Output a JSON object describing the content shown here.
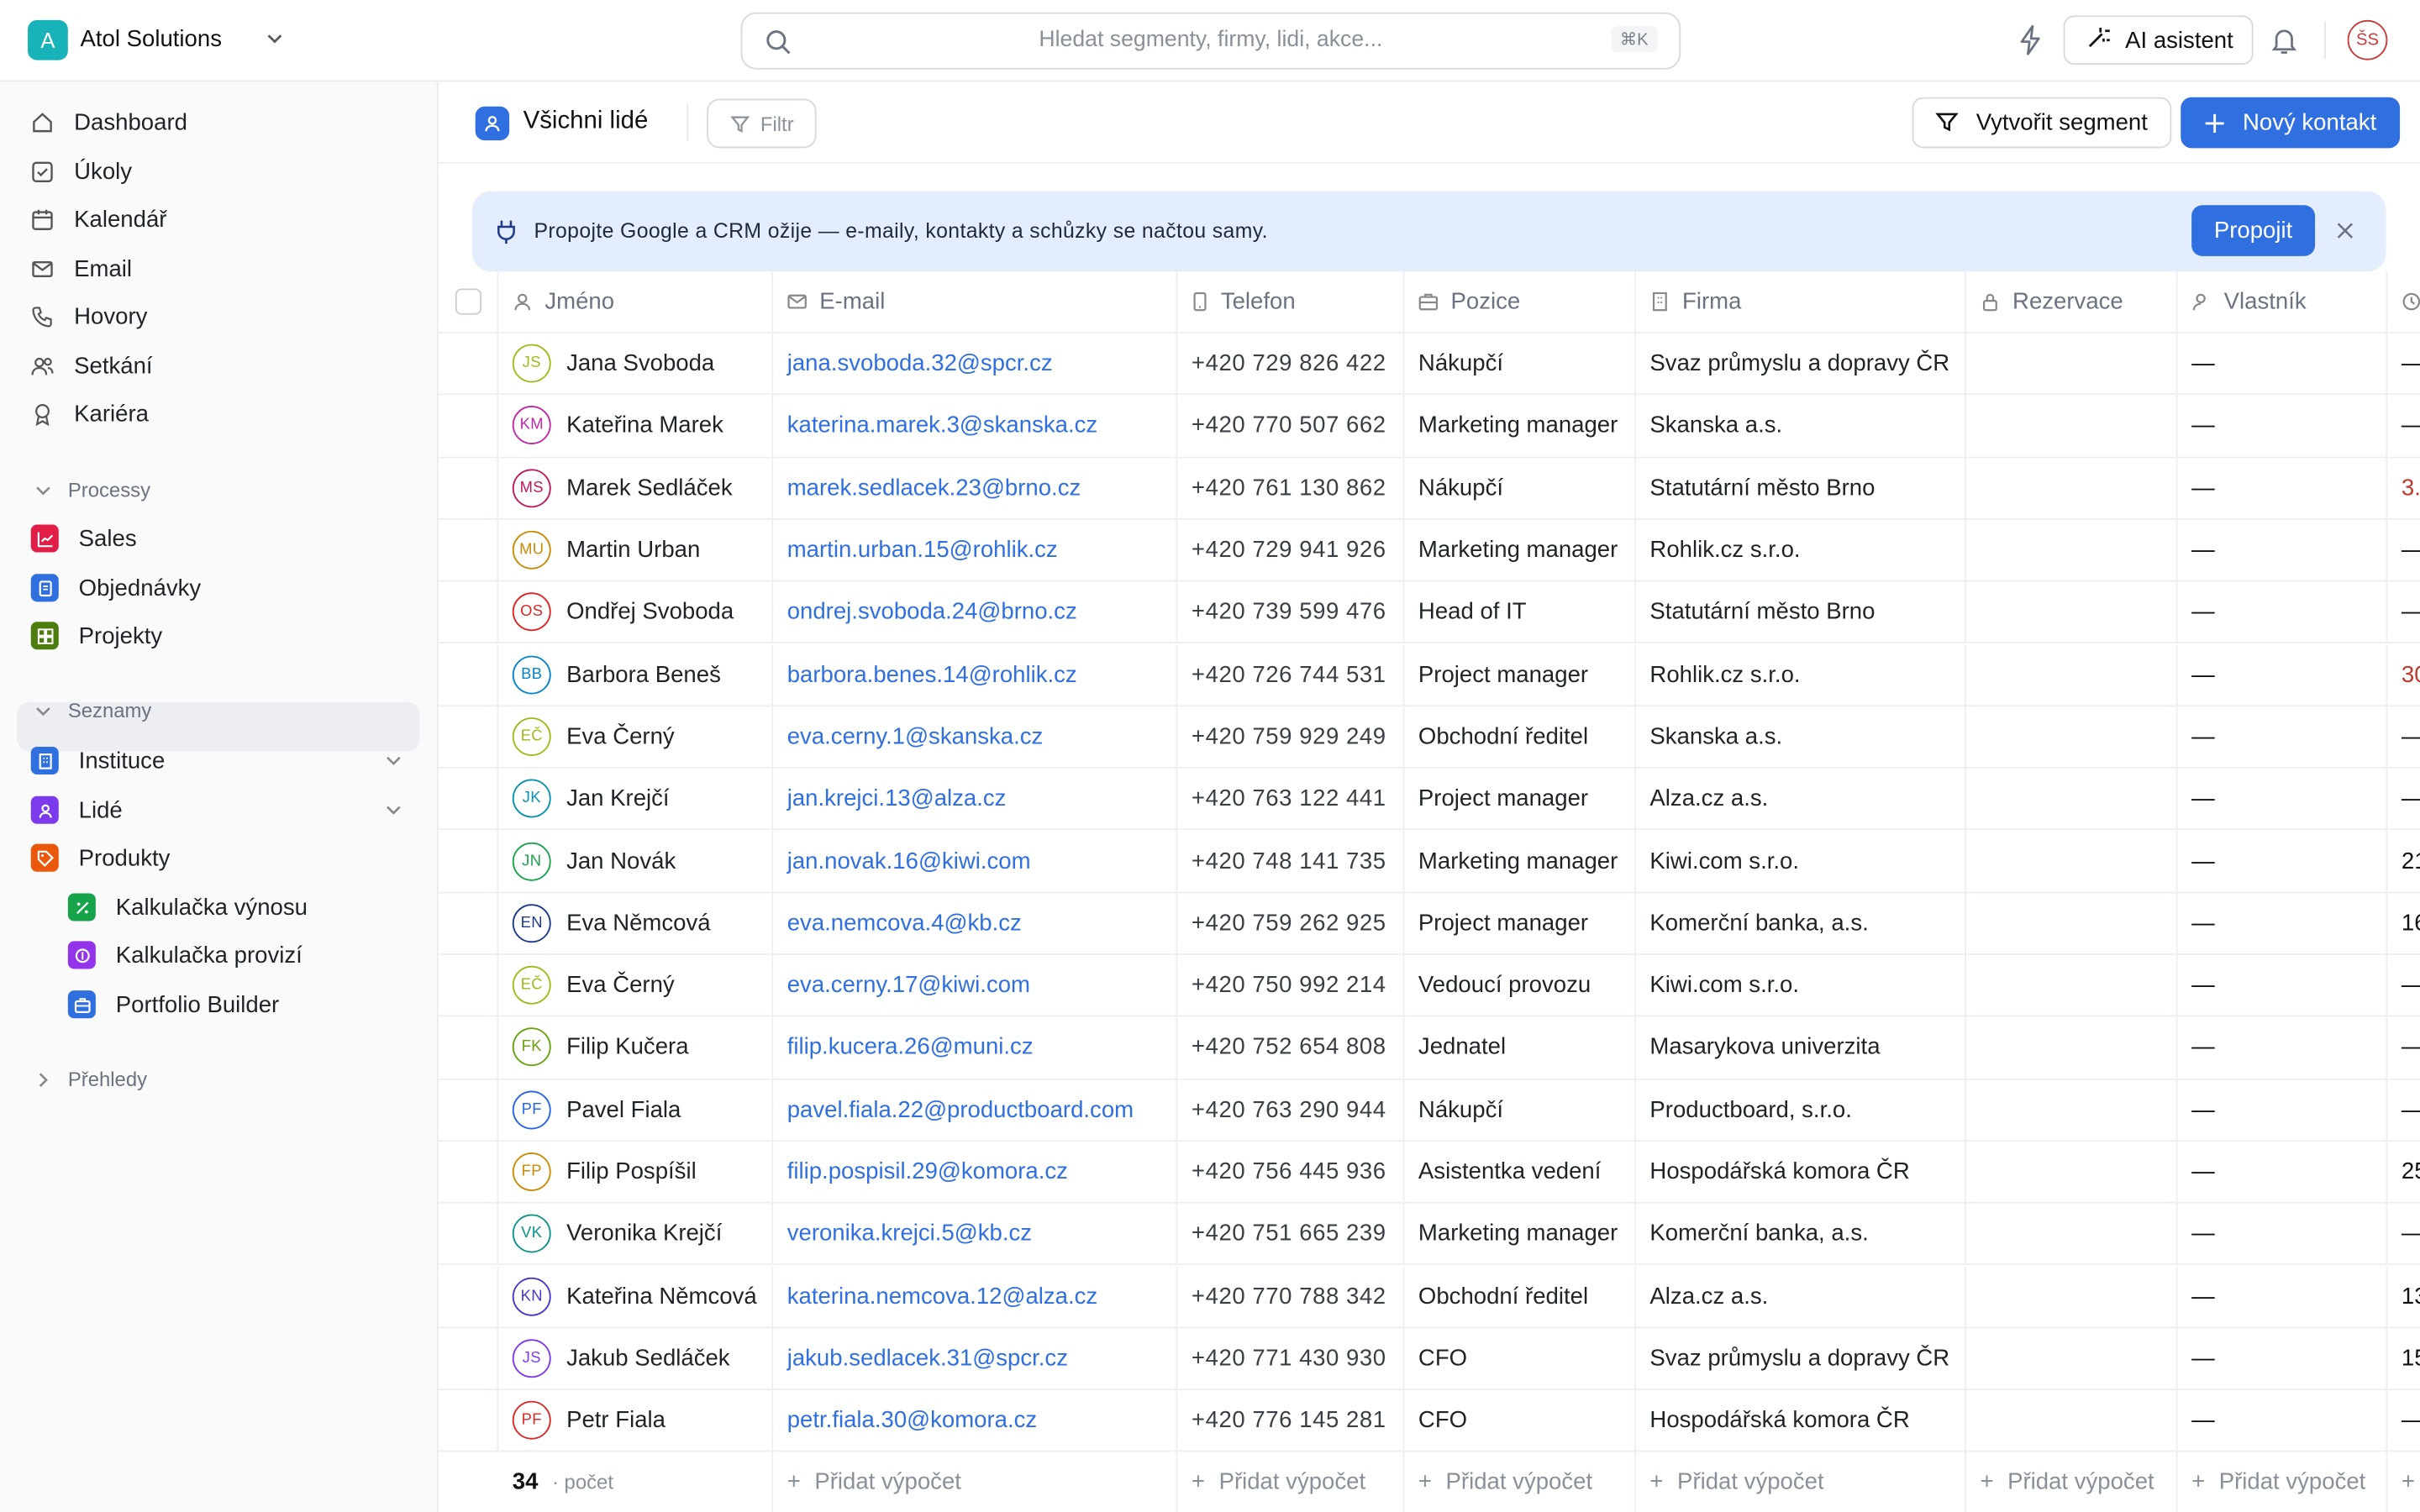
{
  "workspace": {
    "initial": "A",
    "name": "Atol Solutions"
  },
  "search": {
    "placeholder": "Hledat segmenty, firmy, lidi, akce...",
    "shortcut": "⌘K"
  },
  "topbar": {
    "ai_label": "AI asistent",
    "user_initials": "ŠS"
  },
  "sidebar": {
    "nav": [
      "Dashboard",
      "Úkoly",
      "Kalendář",
      "Email",
      "Hovory",
      "Setkání",
      "Kariéra"
    ],
    "processes_header": "Processy",
    "processes": [
      {
        "label": "Sales",
        "color": "#e11d48"
      },
      {
        "label": "Objednávky",
        "color": "#2f6fe0"
      },
      {
        "label": "Projekty",
        "color": "#4d7c0f"
      }
    ],
    "lists_header": "Seznamy",
    "lists": [
      {
        "label": "Instituce",
        "color": "#2f6fe0"
      },
      {
        "label": "Lidé",
        "color": "#7c3aed"
      },
      {
        "label": "Produkty",
        "color": "#ea580c"
      }
    ],
    "products_sub": [
      {
        "label": "Kalkulačka výnosu",
        "color": "#16a34a"
      },
      {
        "label": "Kalkulačka provizí",
        "color": "#9333ea"
      },
      {
        "label": "Portfolio Builder",
        "color": "#2f6fe0"
      }
    ],
    "overviews_header": "Přehledy"
  },
  "view": {
    "title": "Všichni lidé",
    "filter_label": "Filtr",
    "segment_button": "Vytvořit segment",
    "new_button": "Nový kontakt"
  },
  "banner": {
    "text": "Propojte Google a CRM ožije — e-maily, kontakty a schůzky se načtou samy.",
    "button": "Propojit"
  },
  "table": {
    "columns": [
      "Jméno",
      "E-mail",
      "Telefon",
      "Pozice",
      "Firma",
      "Rezervace",
      "Vlastník"
    ],
    "rows": [
      {
        "initials": "JS",
        "color": "#a3b81a",
        "name": "Jana Svoboda",
        "email": "jana.svoboda.32@spcr.cz",
        "phone": "+420 729 826 422",
        "position": "Nákupčí",
        "company": "Svaz průmyslu a dopravy ČR",
        "owner": "—",
        "extra": "—",
        "extra_red": false
      },
      {
        "initials": "KM",
        "color": "#c026a8",
        "name": "Kateřina Marek",
        "email": "katerina.marek.3@skanska.cz",
        "phone": "+420 770 507 662",
        "position": "Marketing manager",
        "company": "Skanska a.s.",
        "owner": "—",
        "extra": "—",
        "extra_red": false
      },
      {
        "initials": "MS",
        "color": "#be185d",
        "name": "Marek Sedláček",
        "email": "marek.sedlacek.23@brno.cz",
        "phone": "+420 761 130 862",
        "position": "Nákupčí",
        "company": "Statutární město Brno",
        "owner": "—",
        "extra": "3.",
        "extra_red": true
      },
      {
        "initials": "MU",
        "color": "#ca8a04",
        "name": "Martin Urban",
        "email": "martin.urban.15@rohlik.cz",
        "phone": "+420 729 941 926",
        "position": "Marketing manager",
        "company": "Rohlik.cz s.r.o.",
        "owner": "—",
        "extra": "—",
        "extra_red": false
      },
      {
        "initials": "OS",
        "color": "#dc2626",
        "name": "Ondřej Svoboda",
        "email": "ondrej.svoboda.24@brno.cz",
        "phone": "+420 739 599 476",
        "position": "Head of IT",
        "company": "Statutární město Brno",
        "owner": "—",
        "extra": "—",
        "extra_red": false
      },
      {
        "initials": "BB",
        "color": "#0284c7",
        "name": "Barbora Beneš",
        "email": "barbora.benes.14@rohlik.cz",
        "phone": "+420 726 744 531",
        "position": "Project manager",
        "company": "Rohlik.cz s.r.o.",
        "owner": "—",
        "extra": "30",
        "extra_red": true
      },
      {
        "initials": "EČ",
        "color": "#a3b81a",
        "name": "Eva Černý",
        "email": "eva.cerny.1@skanska.cz",
        "phone": "+420 759 929 249",
        "position": "Obchodní ředitel",
        "company": "Skanska a.s.",
        "owner": "—",
        "extra": "—",
        "extra_red": false
      },
      {
        "initials": "JK",
        "color": "#0891b2",
        "name": "Jan Krejčí",
        "email": "jan.krejci.13@alza.cz",
        "phone": "+420 763 122 441",
        "position": "Project manager",
        "company": "Alza.cz a.s.",
        "owner": "—",
        "extra": "—",
        "extra_red": false
      },
      {
        "initials": "JN",
        "color": "#16a34a",
        "name": "Jan Novák",
        "email": "jan.novak.16@kiwi.com",
        "phone": "+420 748 141 735",
        "position": "Marketing manager",
        "company": "Kiwi.com s.r.o.",
        "owner": "—",
        "extra": "21",
        "extra_red": false
      },
      {
        "initials": "EN",
        "color": "#1e3a8a",
        "name": "Eva Němcová",
        "email": "eva.nemcova.4@kb.cz",
        "phone": "+420 759 262 925",
        "position": "Project manager",
        "company": "Komerční banka, a.s.",
        "owner": "—",
        "extra": "16",
        "extra_red": false
      },
      {
        "initials": "EČ",
        "color": "#a3b81a",
        "name": "Eva Černý",
        "email": "eva.cerny.17@kiwi.com",
        "phone": "+420 750 992 214",
        "position": "Vedoucí provozu",
        "company": "Kiwi.com s.r.o.",
        "owner": "—",
        "extra": "—",
        "extra_red": false
      },
      {
        "initials": "FK",
        "color": "#65a30d",
        "name": "Filip Kučera",
        "email": "filip.kucera.26@muni.cz",
        "phone": "+420 752 654 808",
        "position": "Jednatel",
        "company": "Masarykova univerzita",
        "owner": "—",
        "extra": "—",
        "extra_red": false
      },
      {
        "initials": "PF",
        "color": "#2563eb",
        "name": "Pavel Fiala",
        "email": "pavel.fiala.22@productboard.com",
        "phone": "+420 763 290 944",
        "position": "Nákupčí",
        "company": "Productboard, s.r.o.",
        "owner": "—",
        "extra": "—",
        "extra_red": false
      },
      {
        "initials": "FP",
        "color": "#ca8a04",
        "name": "Filip Pospíšil",
        "email": "filip.pospisil.29@komora.cz",
        "phone": "+420 756 445 936",
        "position": "Asistentka vedení",
        "company": "Hospodářská komora ČR",
        "owner": "—",
        "extra": "25",
        "extra_red": false
      },
      {
        "initials": "VK",
        "color": "#0d9488",
        "name": "Veronika Krejčí",
        "email": "veronika.krejci.5@kb.cz",
        "phone": "+420 751 665 239",
        "position": "Marketing manager",
        "company": "Komerční banka, a.s.",
        "owner": "—",
        "extra": "—",
        "extra_red": false
      },
      {
        "initials": "KN",
        "color": "#4338ca",
        "name": "Kateřina Němcová",
        "email": "katerina.nemcova.12@alza.cz",
        "phone": "+420 770 788 342",
        "position": "Obchodní ředitel",
        "company": "Alza.cz a.s.",
        "owner": "—",
        "extra": "13",
        "extra_red": false
      },
      {
        "initials": "JS",
        "color": "#7c3aed",
        "name": "Jakub Sedláček",
        "email": "jakub.sedlacek.31@spcr.cz",
        "phone": "+420 771 430 930",
        "position": "CFO",
        "company": "Svaz průmyslu a dopravy ČR",
        "owner": "—",
        "extra": "15",
        "extra_red": false
      },
      {
        "initials": "PF",
        "color": "#dc2626",
        "name": "Petr Fiala",
        "email": "petr.fiala.30@komora.cz",
        "phone": "+420 776 145 281",
        "position": "CFO",
        "company": "Hospodářská komora ČR",
        "owner": "—",
        "extra": "—",
        "extra_red": false
      }
    ],
    "footer": {
      "count": "34",
      "count_label": "· počet",
      "add_calc": "Přidat výpočet"
    }
  }
}
